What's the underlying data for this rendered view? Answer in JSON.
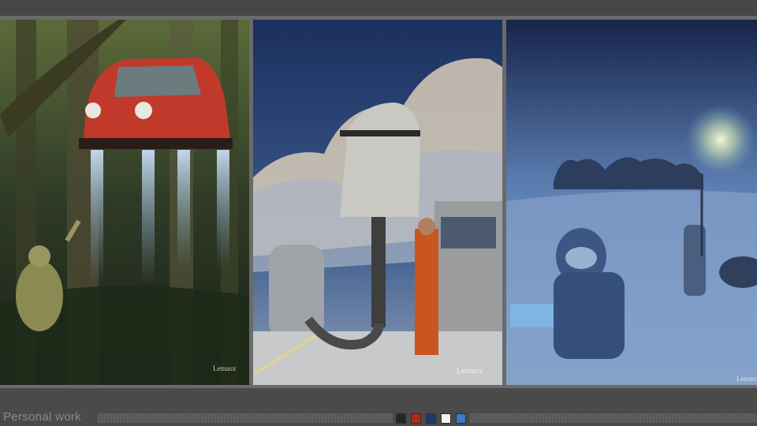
{
  "gallery": {
    "section_title": "Personal work",
    "artworks": [
      {
        "name": "Flying car in jungle",
        "signature": "Lemaux"
      },
      {
        "name": "Robot arm and pod",
        "signature": "Lemaux"
      },
      {
        "name": "Frozen planet explorers",
        "signature": "Lemaux"
      }
    ],
    "thumbnails": [
      {
        "color": "#1f2a22"
      },
      {
        "color": "#b22a1a"
      },
      {
        "color": "#1d3b6b"
      },
      {
        "color": "#f2f2f2"
      },
      {
        "color": "#3f78c9"
      }
    ]
  }
}
